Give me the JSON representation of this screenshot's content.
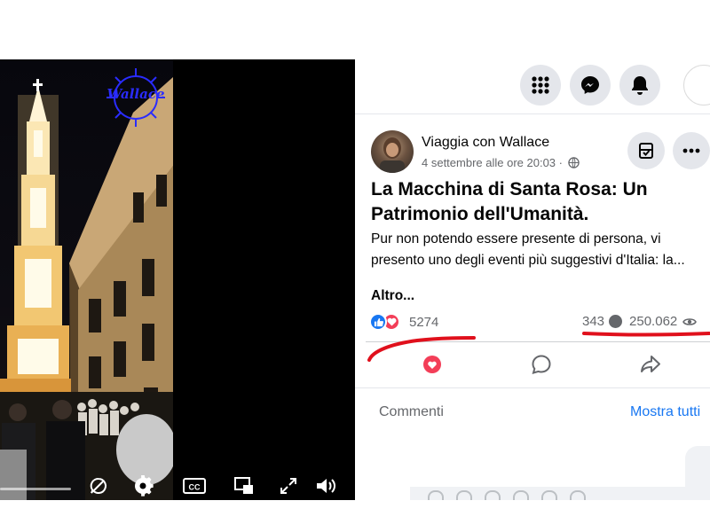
{
  "video": {
    "logo_text": "Wallace",
    "controls": {
      "captions_label": "CC"
    }
  },
  "nav": {
    "icons": [
      "grid-menu-icon",
      "messenger-icon",
      "bell-icon"
    ]
  },
  "post": {
    "author": "Viaggia con Wallace",
    "timestamp": "4 settembre alle ore 20:03 · ",
    "title": "La Macchina di Santa Rosa: Un Patrimonio dell'Umanità.",
    "body": "Pur non potendo essere presente di persona, vi presento uno degli eventi più suggestivi d'Italia: la...",
    "more_label": "Altro...",
    "reactions_count": "5274",
    "comments_count": "343",
    "views_count": "250.062"
  },
  "comments": {
    "label": "Commenti",
    "show_all_label": "Mostra tutti"
  },
  "colors": {
    "fb_blue": "#1877f2",
    "love_red": "#f33e58",
    "annotation_red": "#e0101c",
    "logo_blue": "#2a2cff"
  }
}
